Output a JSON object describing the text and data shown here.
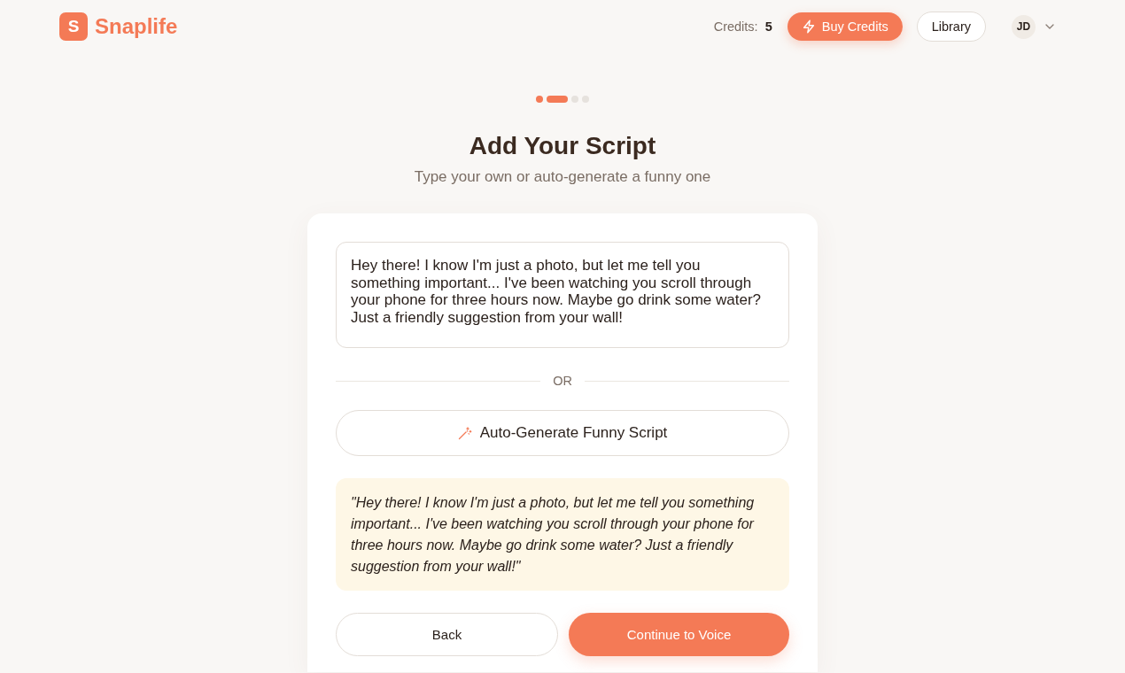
{
  "header": {
    "logo": {
      "letter": "S",
      "name": "Snaplife"
    },
    "credits": {
      "label": "Credits:",
      "value": "5"
    },
    "buy_button": {
      "label": "Buy Credits"
    },
    "library_button": {
      "label": "Library"
    },
    "user": {
      "initials": "JD"
    }
  },
  "steps": [
    {
      "kind": "done"
    },
    {
      "kind": "current"
    },
    {
      "kind": "upcoming"
    },
    {
      "kind": "upcoming"
    }
  ],
  "page": {
    "title": "Add Your Script",
    "subtitle": "Type your own or auto-generate a funny one"
  },
  "script_card": {
    "script_field": {
      "value": "Hey there! I know I'm just a photo, but let me tell you something important... I've been watching you scroll through your phone for three hours now. Maybe go drink some water? Just a friendly suggestion from your wall!"
    },
    "divider_label": "OR",
    "generate_button": {
      "label": "Auto-Generate Funny Script"
    },
    "preview": {
      "text": "\"Hey there! I know I'm just a photo, but let me tell you something important... I've been watching you scroll through your phone for three hours now. Maybe go drink some water? Just a friendly suggestion from your wall!\""
    },
    "actions": [
      {
        "kind": "secondary",
        "label": "Back"
      },
      {
        "kind": "primary",
        "label": "Continue to Voice"
      }
    ]
  }
}
